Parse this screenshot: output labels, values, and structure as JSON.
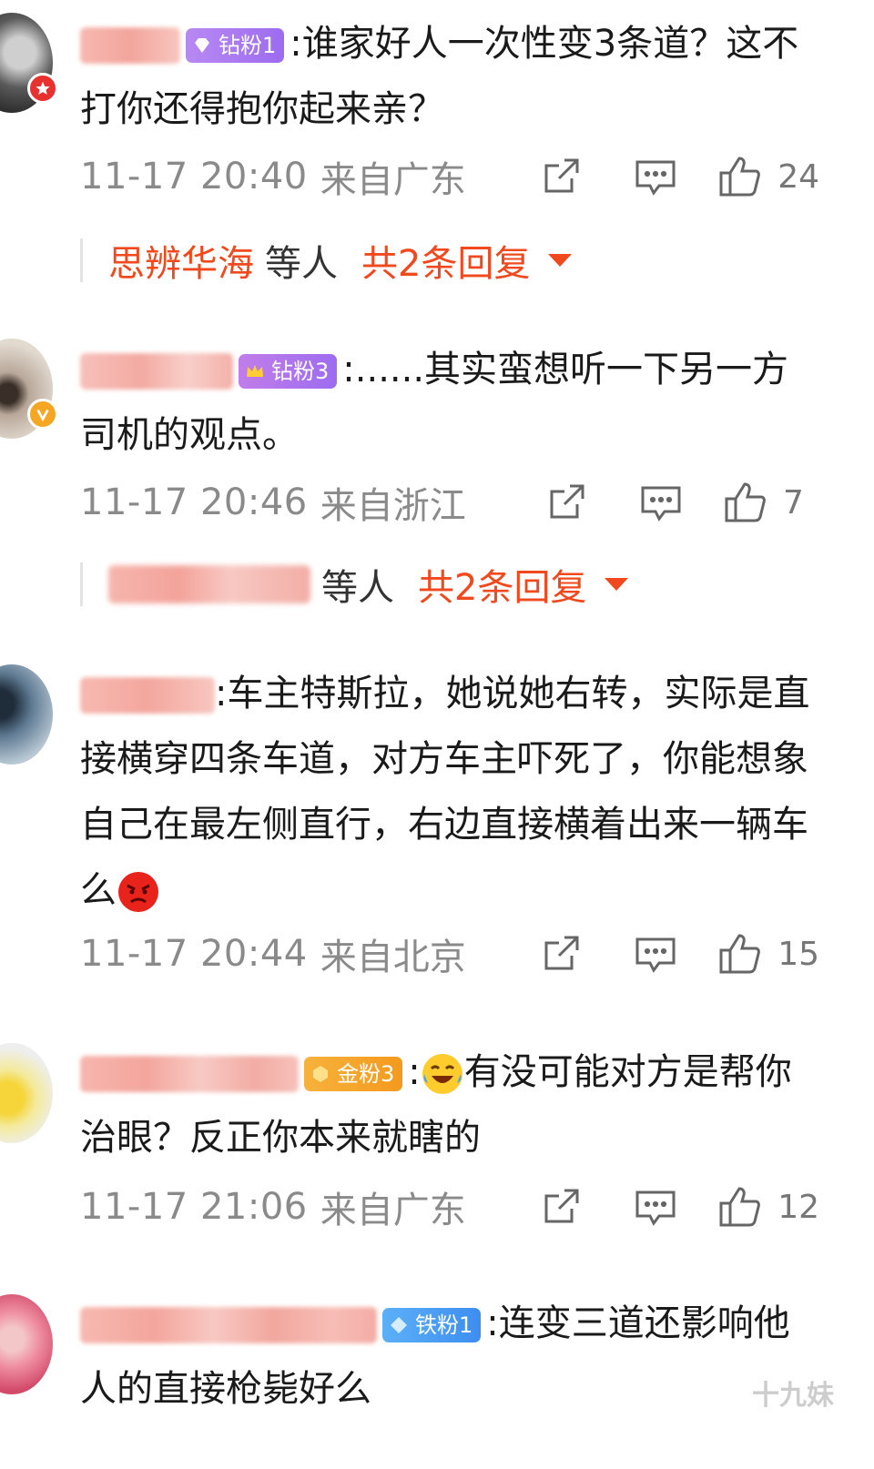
{
  "comments": [
    {
      "badge": "钻粉1",
      "text": ":谁家好人一次性变3条道？这不打你还得抱你起来亲？",
      "time": "11-17 20:40",
      "location": "来自广东",
      "likes": "24",
      "replies": {
        "who": "思辨华海",
        "etc": "等人",
        "count": "共2条回复"
      }
    },
    {
      "badge": "钻粉3",
      "text": ":......其实蛮想听一下另一方司机的观点。",
      "time": "11-17 20:46",
      "location": "来自浙江",
      "likes": "7",
      "replies": {
        "etc": "等人",
        "count": "共2条回复"
      }
    },
    {
      "text": ":车主特斯拉，她说她右转，实际是直接横穿四条车道，对方车主吓死了，你能想象自己在最左侧直行，右边直接横着出来一辆车么",
      "time": "11-17 20:44",
      "location": "来自北京",
      "likes": "15"
    },
    {
      "badge": "金粉3",
      "text_a": ":",
      "text_b": "有没可能对方是帮你治眼？反正你本来就瞎的",
      "time": "11-17 21:06",
      "location": "来自广东",
      "likes": "12"
    },
    {
      "badge": "铁粉1",
      "text": ":连变三道还影响他人的直接枪毙好么"
    }
  ],
  "watermark": "十九妹",
  "colors": {
    "accent": "#f1491e",
    "meta": "#8a8a8a",
    "badge_diamond": "#a874ee",
    "badge_gold": "#f5a623",
    "badge_iron": "#4a9ff5"
  }
}
